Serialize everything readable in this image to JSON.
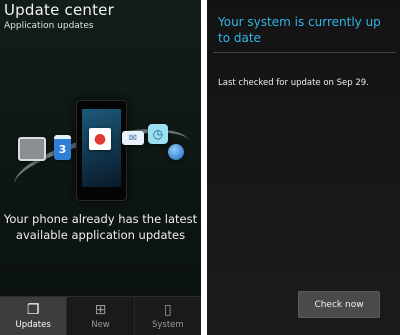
{
  "left_panel": {
    "title": "Update center",
    "subtitle": "Application updates",
    "message_line1": "Your phone already has the latest",
    "message_line2": "available application updates",
    "hero_icons": [
      "film-icon",
      "calendar-icon",
      "contact-icon",
      "mail-icon",
      "clock-icon",
      "globe-icon"
    ],
    "calendar_day": "3",
    "tabs": [
      {
        "label": "Updates",
        "icon": "updates-icon",
        "active": true
      },
      {
        "label": "New",
        "icon": "new-apps-icon",
        "active": false
      },
      {
        "label": "System",
        "icon": "system-phone-icon",
        "active": false
      }
    ]
  },
  "right_panel": {
    "title": "Your system is currently up to date",
    "status": "Last checked for update on Sep 29.",
    "check_button_label": "Check now",
    "title_color": "#33b5e5"
  }
}
